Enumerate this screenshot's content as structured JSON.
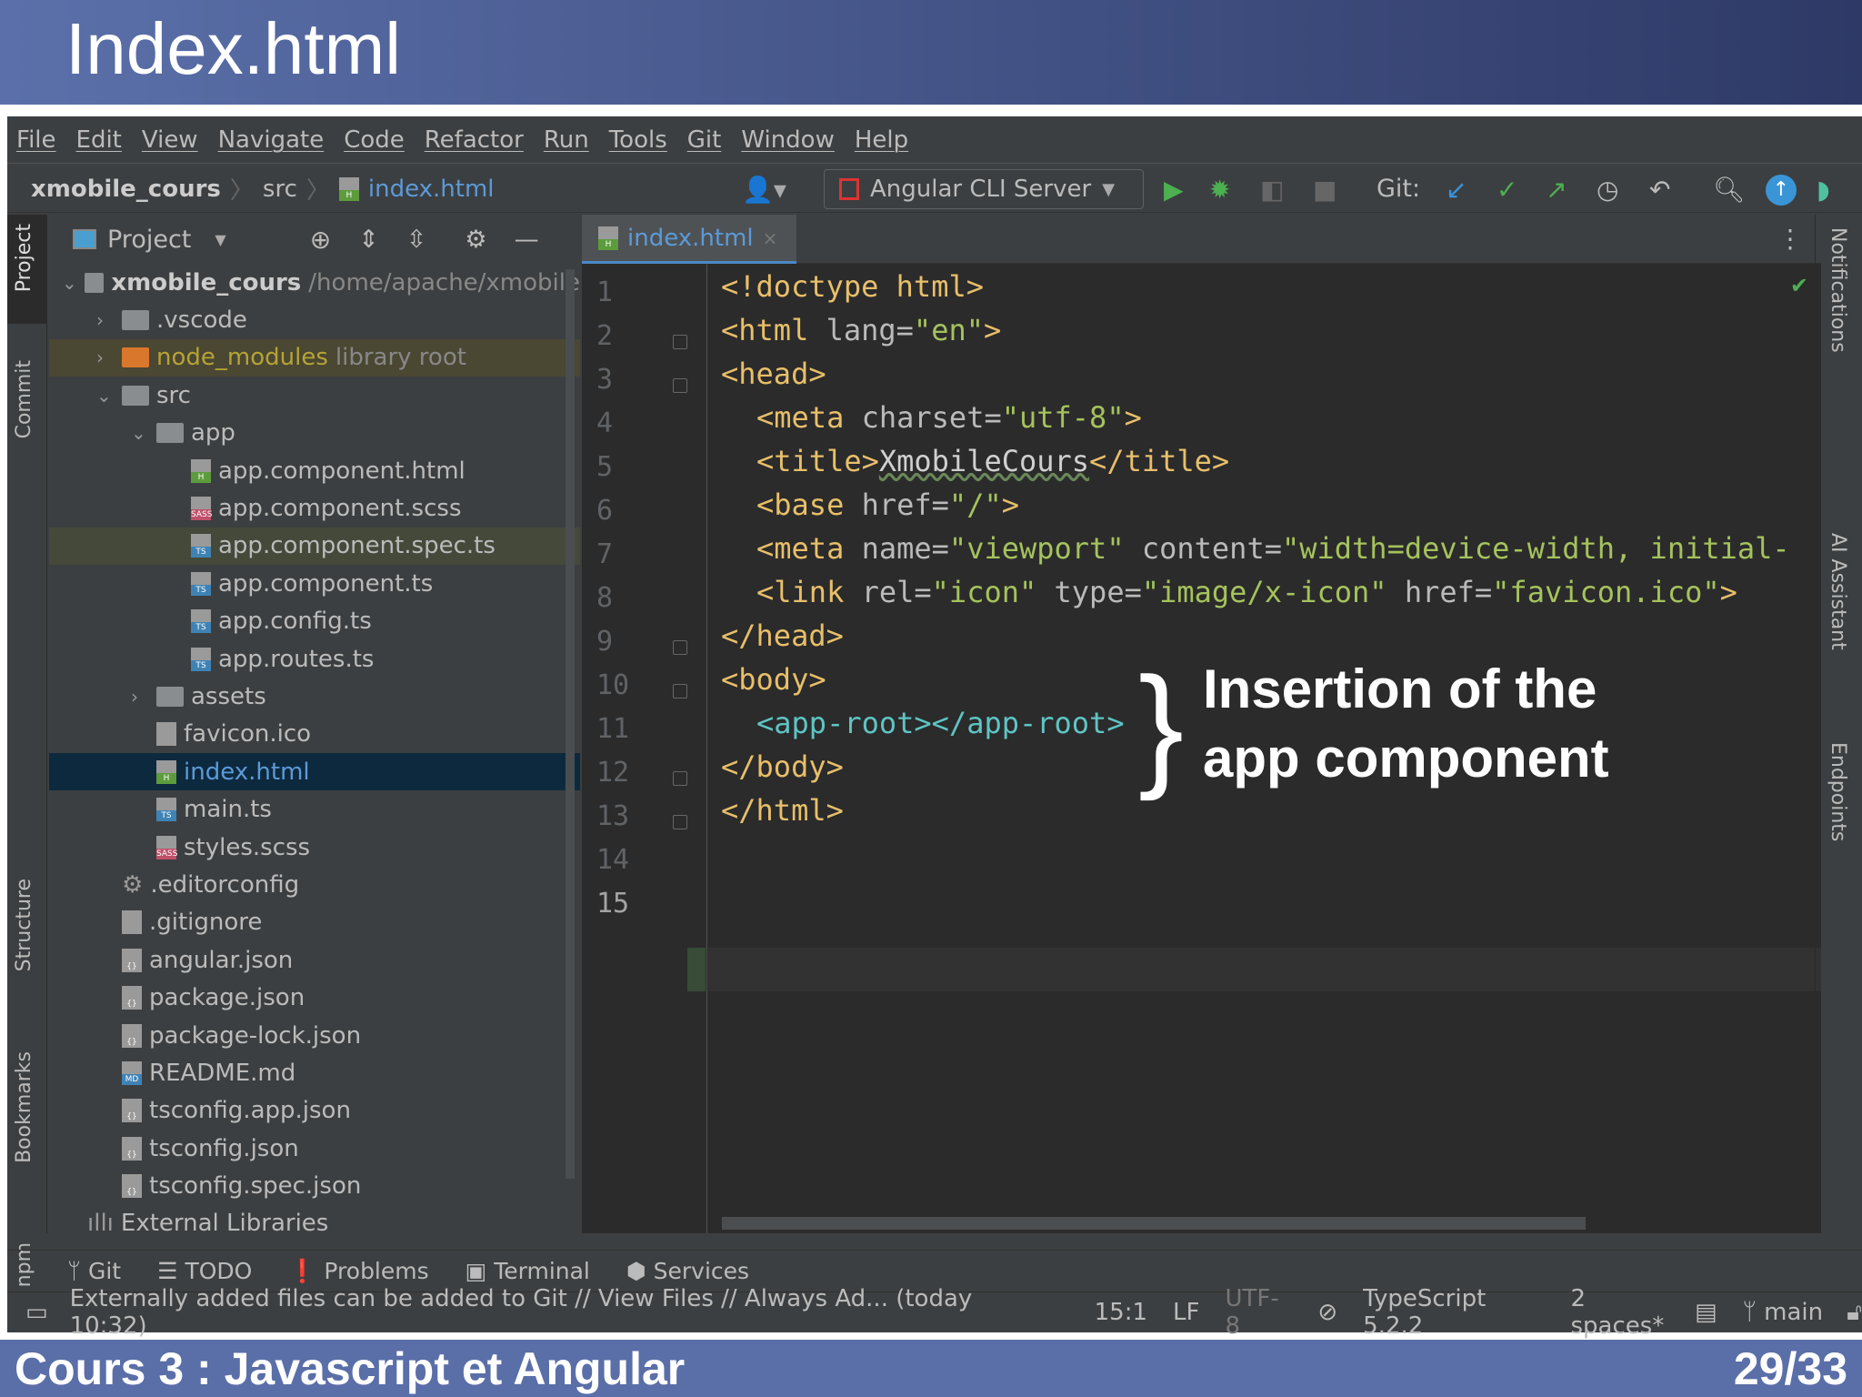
{
  "slide": {
    "title": "Index.html",
    "footer_left": "Cours 3 : Javascript et Angular",
    "footer_right": "29/33"
  },
  "menu": [
    "File",
    "Edit",
    "View",
    "Navigate",
    "Code",
    "Refactor",
    "Run",
    "Tools",
    "Git",
    "Window",
    "Help"
  ],
  "breadcrumb": {
    "project": "xmobile_cours",
    "folder": "src",
    "file": "index.html"
  },
  "toolbar": {
    "run_config": "Angular CLI Server",
    "git_label": "Git:"
  },
  "left_strip": [
    "Project",
    "Commit",
    "Structure",
    "Bookmarks",
    "npm"
  ],
  "right_strip": [
    "Notifications",
    "AI Assistant",
    "Endpoints"
  ],
  "project": {
    "header": "Project",
    "root": {
      "name": "xmobile_cours",
      "path": "/home/apache/xmobile"
    },
    "items": [
      {
        "name": ".vscode",
        "kind": "folder",
        "depth": 1,
        "chev": ">"
      },
      {
        "name": "node_modules",
        "extra": "library root",
        "kind": "folder-lib",
        "depth": 1,
        "chev": ">"
      },
      {
        "name": "src",
        "kind": "folder",
        "depth": 1,
        "chev": "v"
      },
      {
        "name": "app",
        "kind": "folder",
        "depth": 2,
        "chev": "v"
      },
      {
        "name": "app.component.html",
        "kind": "html",
        "depth": 3
      },
      {
        "name": "app.component.scss",
        "kind": "sass",
        "depth": 3
      },
      {
        "name": "app.component.spec.ts",
        "kind": "ts",
        "depth": 3
      },
      {
        "name": "app.component.ts",
        "kind": "ts",
        "depth": 3
      },
      {
        "name": "app.config.ts",
        "kind": "ts",
        "depth": 3
      },
      {
        "name": "app.routes.ts",
        "kind": "ts",
        "depth": 3
      },
      {
        "name": "assets",
        "kind": "folder",
        "depth": 2,
        "chev": ">"
      },
      {
        "name": "favicon.ico",
        "kind": "img",
        "depth": 2
      },
      {
        "name": "index.html",
        "kind": "html",
        "depth": 2
      },
      {
        "name": "main.ts",
        "kind": "ts",
        "depth": 2
      },
      {
        "name": "styles.scss",
        "kind": "sass",
        "depth": 2
      },
      {
        "name": ".editorconfig",
        "kind": "gear",
        "depth": 1
      },
      {
        "name": ".gitignore",
        "kind": "file",
        "depth": 1
      },
      {
        "name": "angular.json",
        "kind": "json",
        "depth": 1
      },
      {
        "name": "package.json",
        "kind": "json",
        "depth": 1
      },
      {
        "name": "package-lock.json",
        "kind": "json",
        "depth": 1
      },
      {
        "name": "README.md",
        "kind": "md",
        "depth": 1
      },
      {
        "name": "tsconfig.app.json",
        "kind": "json",
        "depth": 1
      },
      {
        "name": "tsconfig.json",
        "kind": "json",
        "depth": 1
      },
      {
        "name": "tsconfig.spec.json",
        "kind": "json",
        "depth": 1
      },
      {
        "name": "External Libraries",
        "kind": "lib",
        "depth": 0
      }
    ]
  },
  "editor": {
    "tab": "index.html",
    "line_numbers": [
      "1",
      "2",
      "3",
      "4",
      "5",
      "6",
      "7",
      "8",
      "9",
      "10",
      "11",
      "12",
      "13",
      "14",
      "15"
    ],
    "lines": {
      "l1": "<!doctype html>",
      "l2a": "<html ",
      "l2b": "lang=",
      "l2c": "\"en\"",
      "l2d": ">",
      "l3": "<head>",
      "l4a": "<meta ",
      "l4b": "charset=",
      "l4c": "\"utf-8\"",
      "l4d": ">",
      "l5a": "<title>",
      "l5b": "XmobileCours",
      "l5c": "</title>",
      "l6a": "<base ",
      "l6b": "href=",
      "l6c": "\"/\"",
      "l6d": ">",
      "l7a": "<meta ",
      "l7b": "name=",
      "l7c": "\"viewport\"",
      "l7d": " content=",
      "l7e": "\"width=device-width, initial-",
      "l8a": "<link ",
      "l8b": "rel=",
      "l8c": "\"icon\"",
      "l8d": " type=",
      "l8e": "\"image/x-icon\"",
      "l8f": " href=",
      "l8g": "\"favicon.ico\"",
      "l8h": ">",
      "l9": "</head>",
      "l10": "<body>",
      "l11a": "<app-root></app-root>",
      "l12": "</body>",
      "l13": "</html>"
    }
  },
  "annotation": {
    "line1": "Insertion of the",
    "line2": "app component"
  },
  "bottom_tabs": [
    "Git",
    "TODO",
    "Problems",
    "Terminal",
    "Services"
  ],
  "status": {
    "message": "Externally added files can be added to Git // View Files // Always Ad... (today 10:32)",
    "position": "15:1",
    "line_sep": "LF",
    "encoding": "UTF-8",
    "language": "TypeScript 5.2.2",
    "indent": "2 spaces*",
    "branch": "main"
  }
}
